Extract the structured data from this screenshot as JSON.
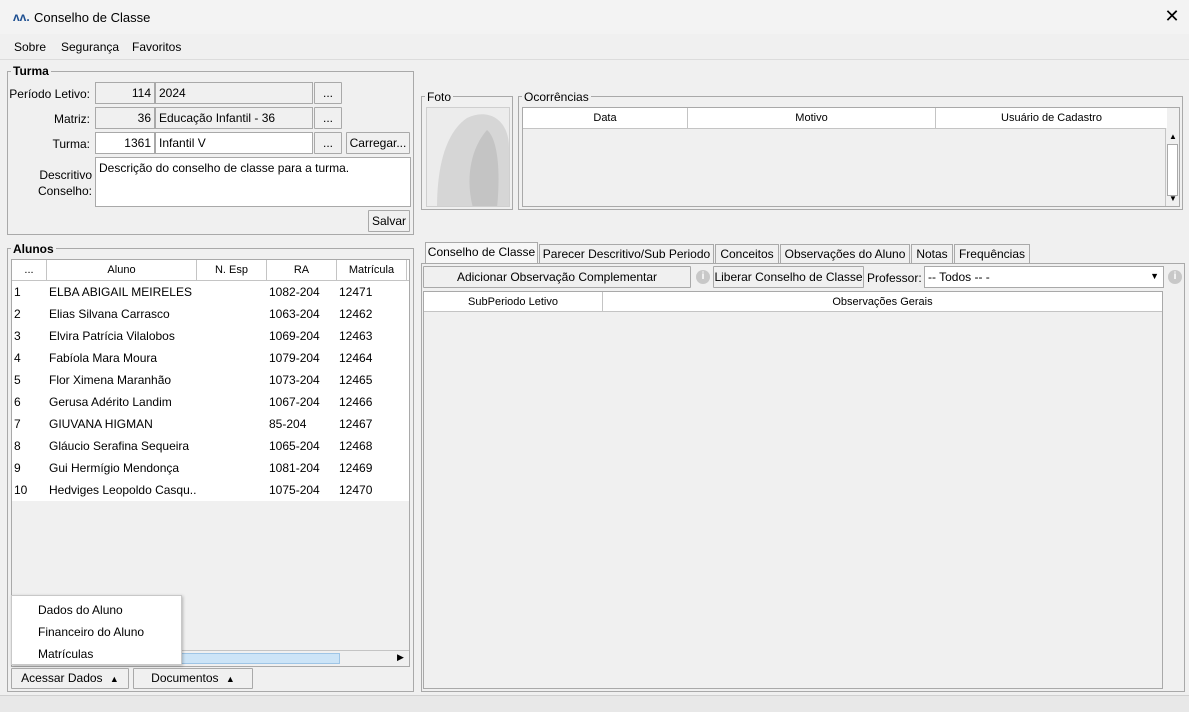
{
  "window": {
    "title": "Conselho de Classe",
    "logo": "ʌʌ."
  },
  "menu": [
    "Sobre",
    "Segurança",
    "Favoritos"
  ],
  "turma": {
    "group_title": "Turma",
    "periodo_label": "Período Letivo:",
    "periodo_code": "114",
    "periodo_value": "2024",
    "matriz_label": "Matriz:",
    "matriz_code": "36",
    "matriz_value": "Educação Infantil - 36",
    "turma_label": "Turma:",
    "turma_code": "1361",
    "turma_value": "Infantil V",
    "ellipsis": "...",
    "carregar_label": "Carregar...",
    "descritivo_label_1": "Descritivo",
    "descritivo_label_2": "Conselho:",
    "descritivo_value": "Descrição do conselho de classe para a turma.",
    "salvar_label": "Salvar"
  },
  "foto": {
    "group_title": "Foto"
  },
  "ocorrencias": {
    "group_title": "Ocorrências",
    "columns": [
      "Data",
      "Motivo",
      "Usuário de Cadastro"
    ]
  },
  "alunos": {
    "group_title": "Alunos",
    "columns": [
      "...",
      "Aluno",
      "N. Esp",
      "RA",
      "Matrícula"
    ],
    "rows": [
      {
        "n": "1",
        "nome": "ELBA ABIGAIL MEIRELES",
        "esp": "",
        "ra": "1082-204",
        "mat": "12471"
      },
      {
        "n": "2",
        "nome": "Elias Silvana Carrasco",
        "esp": "",
        "ra": "1063-204",
        "mat": "12462"
      },
      {
        "n": "3",
        "nome": "Elvira Patrícia Vilalobos",
        "esp": "",
        "ra": "1069-204",
        "mat": "12463"
      },
      {
        "n": "4",
        "nome": "Fabíola Mara Moura",
        "esp": "",
        "ra": "1079-204",
        "mat": "12464"
      },
      {
        "n": "5",
        "nome": "Flor Ximena Maranhão",
        "esp": "",
        "ra": "1073-204",
        "mat": "12465"
      },
      {
        "n": "6",
        "nome": "Gerusa Adérito Landim",
        "esp": "",
        "ra": "1067-204",
        "mat": "12466"
      },
      {
        "n": "7",
        "nome": "GIUVANA HIGMAN",
        "esp": "",
        "ra": "85-204",
        "mat": "12467"
      },
      {
        "n": "8",
        "nome": "Gláucio Serafina Sequeira",
        "esp": "",
        "ra": "1065-204",
        "mat": "12468"
      },
      {
        "n": "9",
        "nome": "Gui Hermígio Mendonça",
        "esp": "",
        "ra": "1081-204",
        "mat": "12469"
      },
      {
        "n": "10",
        "nome": "Hedviges Leopoldo Casqu...",
        "esp": "",
        "ra": "1075-204",
        "mat": "12470"
      }
    ],
    "popup_items": [
      "Dados do Aluno",
      "Financeiro do Aluno",
      "Matrículas"
    ],
    "acessar_label": "Acessar Dados",
    "documentos_label": "Documentos"
  },
  "tabs": [
    "Conselho de Classe",
    "Parecer Descritivo/Sub Periodo",
    "Conceitos",
    "Observações do Aluno",
    "Notas",
    "Frequências"
  ],
  "conselho": {
    "add_obs_label": "Adicionar Observação Complementar",
    "liberar_label": "Liberar Conselho de Classe",
    "professor_label": "Professor:",
    "professor_value": "-- Todos -- -",
    "columns": [
      "SubPeriodo Letivo",
      "Observações Gerais"
    ]
  }
}
